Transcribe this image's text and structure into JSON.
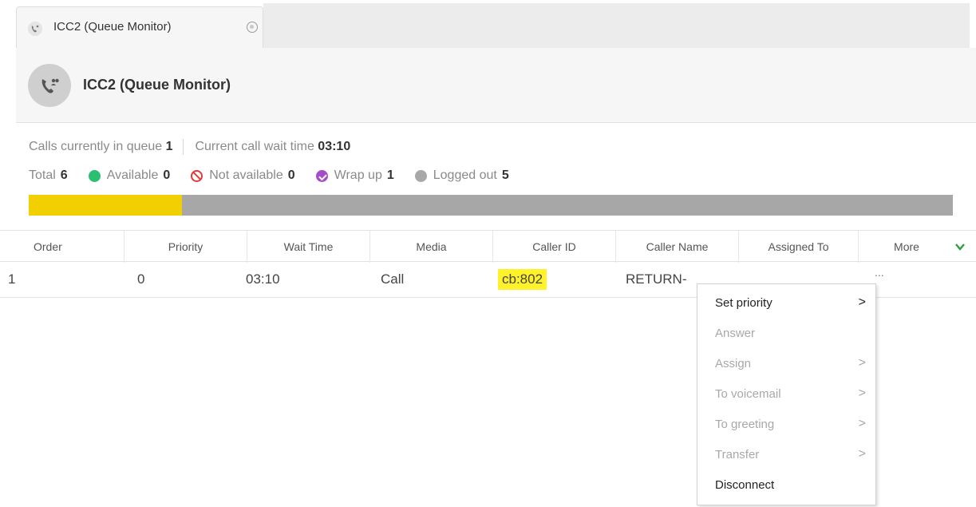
{
  "tab": {
    "label": "ICC2 (Queue Monitor)",
    "icon": "queue-phone-icon",
    "close_icon": "close-icon"
  },
  "header": {
    "title": "ICC2 (Queue Monitor)",
    "avatar_icon": "queue-phone-icon"
  },
  "stats": {
    "calls_in_queue_label": "Calls currently in queue",
    "calls_in_queue_value": "1",
    "wait_time_label": "Current call wait time",
    "wait_time_value": "03:10",
    "total_label": "Total",
    "total_value": "6",
    "available_label": "Available",
    "available_value": "0",
    "not_available_label": "Not available",
    "not_available_value": "0",
    "wrap_up_label": "Wrap up",
    "wrap_up_value": "1",
    "logged_out_label": "Logged out",
    "logged_out_value": "5",
    "progress_fraction": 0.166,
    "colors": {
      "available": "#2cbf72",
      "not_available": "#e23a3a",
      "wrap_up": "#a64cc9",
      "logged_out": "#a8a8a8",
      "progress_fill": "#f2cf00",
      "progress_track": "#a7a7a7"
    }
  },
  "table": {
    "columns": [
      "Order",
      "Priority",
      "Wait Time",
      "Media",
      "Caller ID",
      "Caller Name",
      "Assigned To",
      "More"
    ],
    "rows": [
      {
        "order": "1",
        "priority": "0",
        "wait_time": "03:10",
        "media": "Call",
        "caller_id": "cb:802",
        "caller_name": "RETURN-",
        "more": "..."
      }
    ],
    "highlight_color": "#fff12a"
  },
  "context_menu": {
    "items": [
      {
        "label": "Set priority",
        "enabled": true,
        "submenu": true
      },
      {
        "label": "Answer",
        "enabled": false,
        "submenu": false
      },
      {
        "label": "Assign",
        "enabled": false,
        "submenu": true
      },
      {
        "label": "To voicemail",
        "enabled": false,
        "submenu": true
      },
      {
        "label": "To greeting",
        "enabled": false,
        "submenu": true
      },
      {
        "label": "Transfer",
        "enabled": false,
        "submenu": true
      },
      {
        "label": "Disconnect",
        "enabled": true,
        "submenu": false
      }
    ],
    "submenu_arrow": ">"
  }
}
